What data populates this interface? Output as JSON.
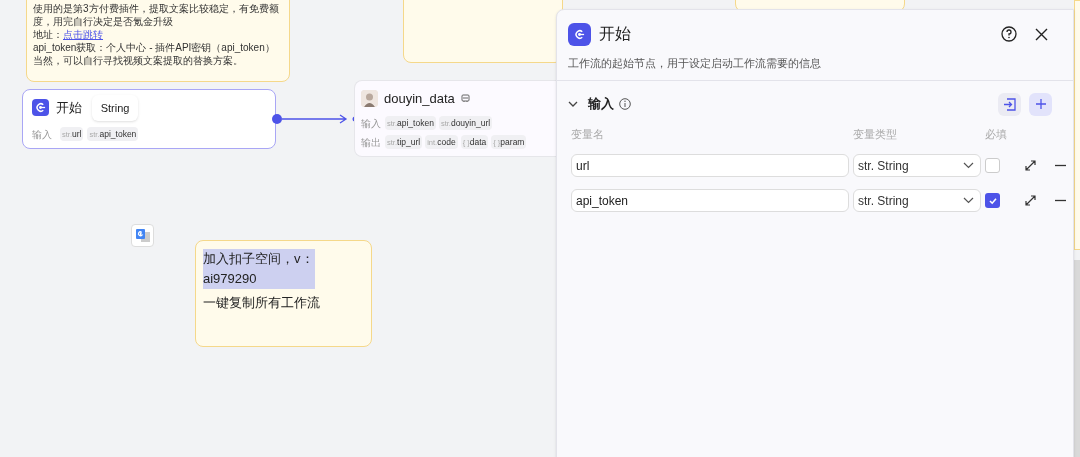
{
  "canvas": {
    "notes": [
      {
        "lines": [
          {
            "text": "使用的是第3方付费插件，提取文案比较稳定，有免费额度，用完自行决定是否氪金升级"
          },
          {
            "text": "地址：",
            "link": "点击跳转"
          },
          {
            "text": "api_token获取：个人中心 - 插件API密钥（api_token）"
          },
          {
            "text": "当然，可以自行寻找视频文案提取的替换方案。"
          }
        ]
      },
      {
        "lines": [
          "加入扣子空间，v：ai979290",
          "一键复制所有工作流"
        ],
        "highlight_first": true
      }
    ],
    "start_node": {
      "title": "开始",
      "inputs_label": "输入",
      "inputs": [
        {
          "type": "str.",
          "name": "url"
        },
        {
          "type": "str.",
          "name": "api_token"
        }
      ],
      "tooltip": "String"
    },
    "plugin_node": {
      "title": "douyin_data",
      "inputs_label": "输入",
      "inputs": [
        {
          "type": "str.",
          "name": "api_token"
        },
        {
          "type": "str.",
          "name": "douyin_url"
        }
      ],
      "outputs_label": "输出",
      "outputs": [
        {
          "type": "str.",
          "name": "tip_url"
        },
        {
          "type": "int.",
          "name": "code"
        },
        {
          "type": "{ }",
          "name": "data"
        },
        {
          "type": "{ }",
          "name": "param"
        }
      ]
    }
  },
  "panel": {
    "title": "开始",
    "description": "工作流的起始节点，用于设定启动工作流需要的信息",
    "section": {
      "title": "输入",
      "expanded": true
    },
    "columns": [
      "变量名",
      "变量类型",
      "必填"
    ],
    "rows": [
      {
        "name": "url",
        "type": "str. String",
        "required": false
      },
      {
        "name": "api_token",
        "type": "str. String",
        "required": true
      }
    ]
  }
}
